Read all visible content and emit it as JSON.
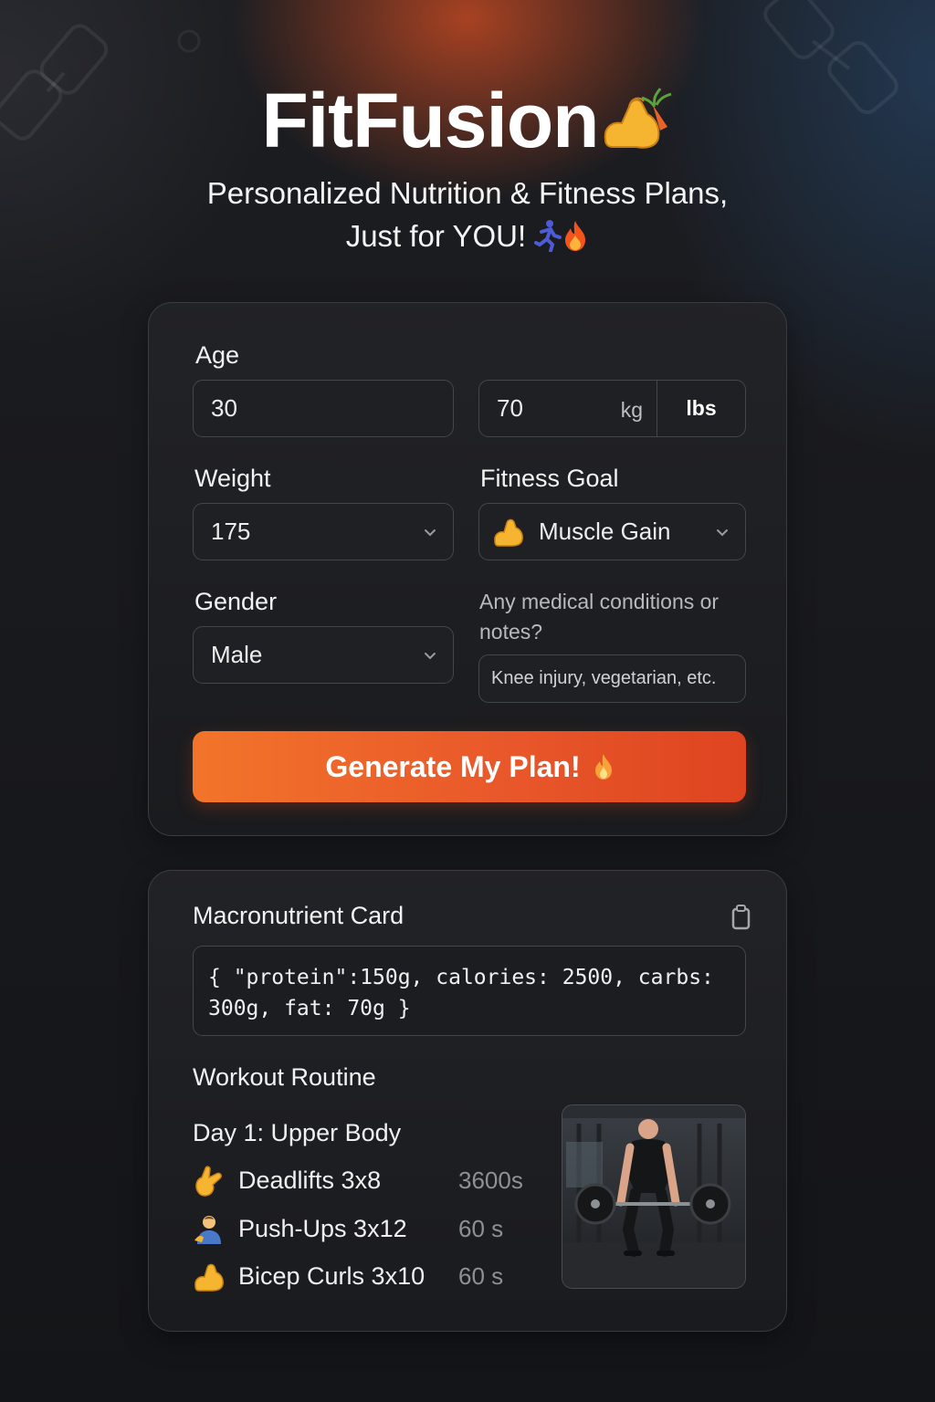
{
  "app": {
    "title": "FitFusion",
    "subtitle_line1": "Personalized Nutrition & Fitness Plans,",
    "subtitle_line2": "Just for YOU!"
  },
  "form": {
    "age": {
      "label": "Age",
      "value": "30"
    },
    "weight_unit_input": {
      "value": "70",
      "unit_kg": "kg",
      "unit_lbs": "lbs",
      "selected_unit": "lbs"
    },
    "weight": {
      "label": "Weight",
      "value": "175"
    },
    "fitness_goal": {
      "label": "Fitness Goal",
      "value": "Muscle Gain",
      "icon": "flexed-biceps-icon"
    },
    "gender": {
      "label": "Gender",
      "value": "Male"
    },
    "notes": {
      "label": "Any medical conditions or notes?",
      "placeholder": "Knee injury, vegetarian, etc."
    },
    "generate_label": "Generate My Plan!"
  },
  "results": {
    "macro_title": "Macronutrient Card",
    "macro_text": "{ \"protein\":150g, calories: 2500, carbs: 300g, fat: 70g }",
    "workout_title": "Workout Routine",
    "day_title": "Day 1:  Upper Body",
    "exercises": [
      {
        "name": "Deadlifts  3x8",
        "rest": "3600s",
        "icon": "pinching-hand-icon"
      },
      {
        "name": "Push-Ups  3x12",
        "rest": "60 s",
        "icon": "person-icon"
      },
      {
        "name": "Bicep Curls  3x10",
        "rest": "60 s",
        "icon": "flexed-biceps-icon"
      }
    ]
  },
  "colors": {
    "accent": "#e9582a",
    "background": "#17181b",
    "card_border": "#3a3c42"
  }
}
